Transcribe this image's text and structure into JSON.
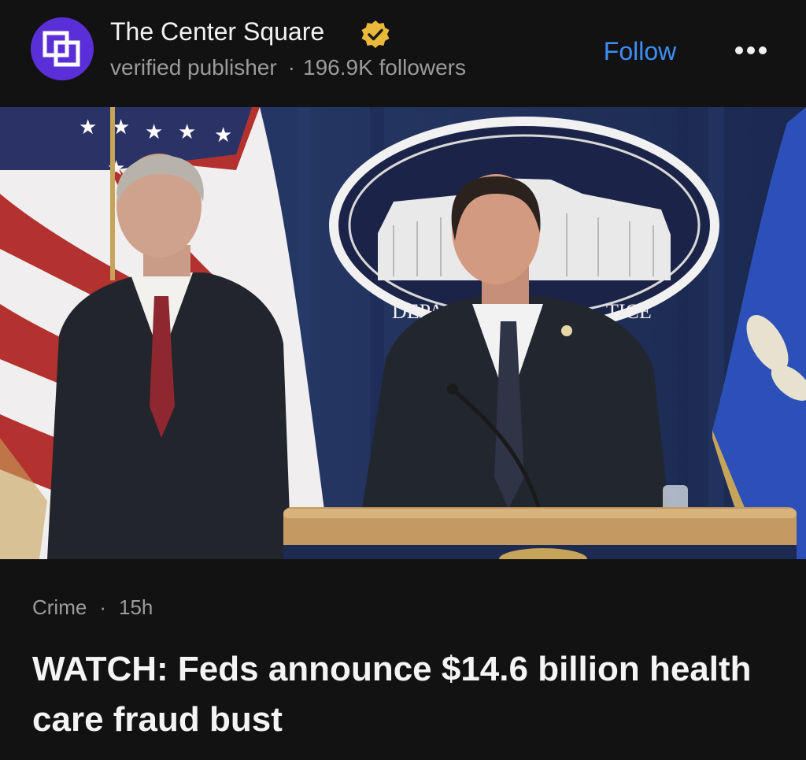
{
  "publisher": {
    "name": "The Center Square",
    "subtitle": "verified publisher",
    "followers": "196.9K followers",
    "avatar_color": "#5b2fd8",
    "badge_color": "#e8b93a"
  },
  "actions": {
    "follow_label": "Follow",
    "follow_color": "#3d8ef7",
    "more_icon": "more-horizontal-icon"
  },
  "media": {
    "description_text": "DEPA",
    "seal_text_right": "TICE"
  },
  "article": {
    "category": "Crime",
    "age": "15h",
    "headline": "WATCH: Feds announce $14.6 billion health care fraud bust"
  }
}
